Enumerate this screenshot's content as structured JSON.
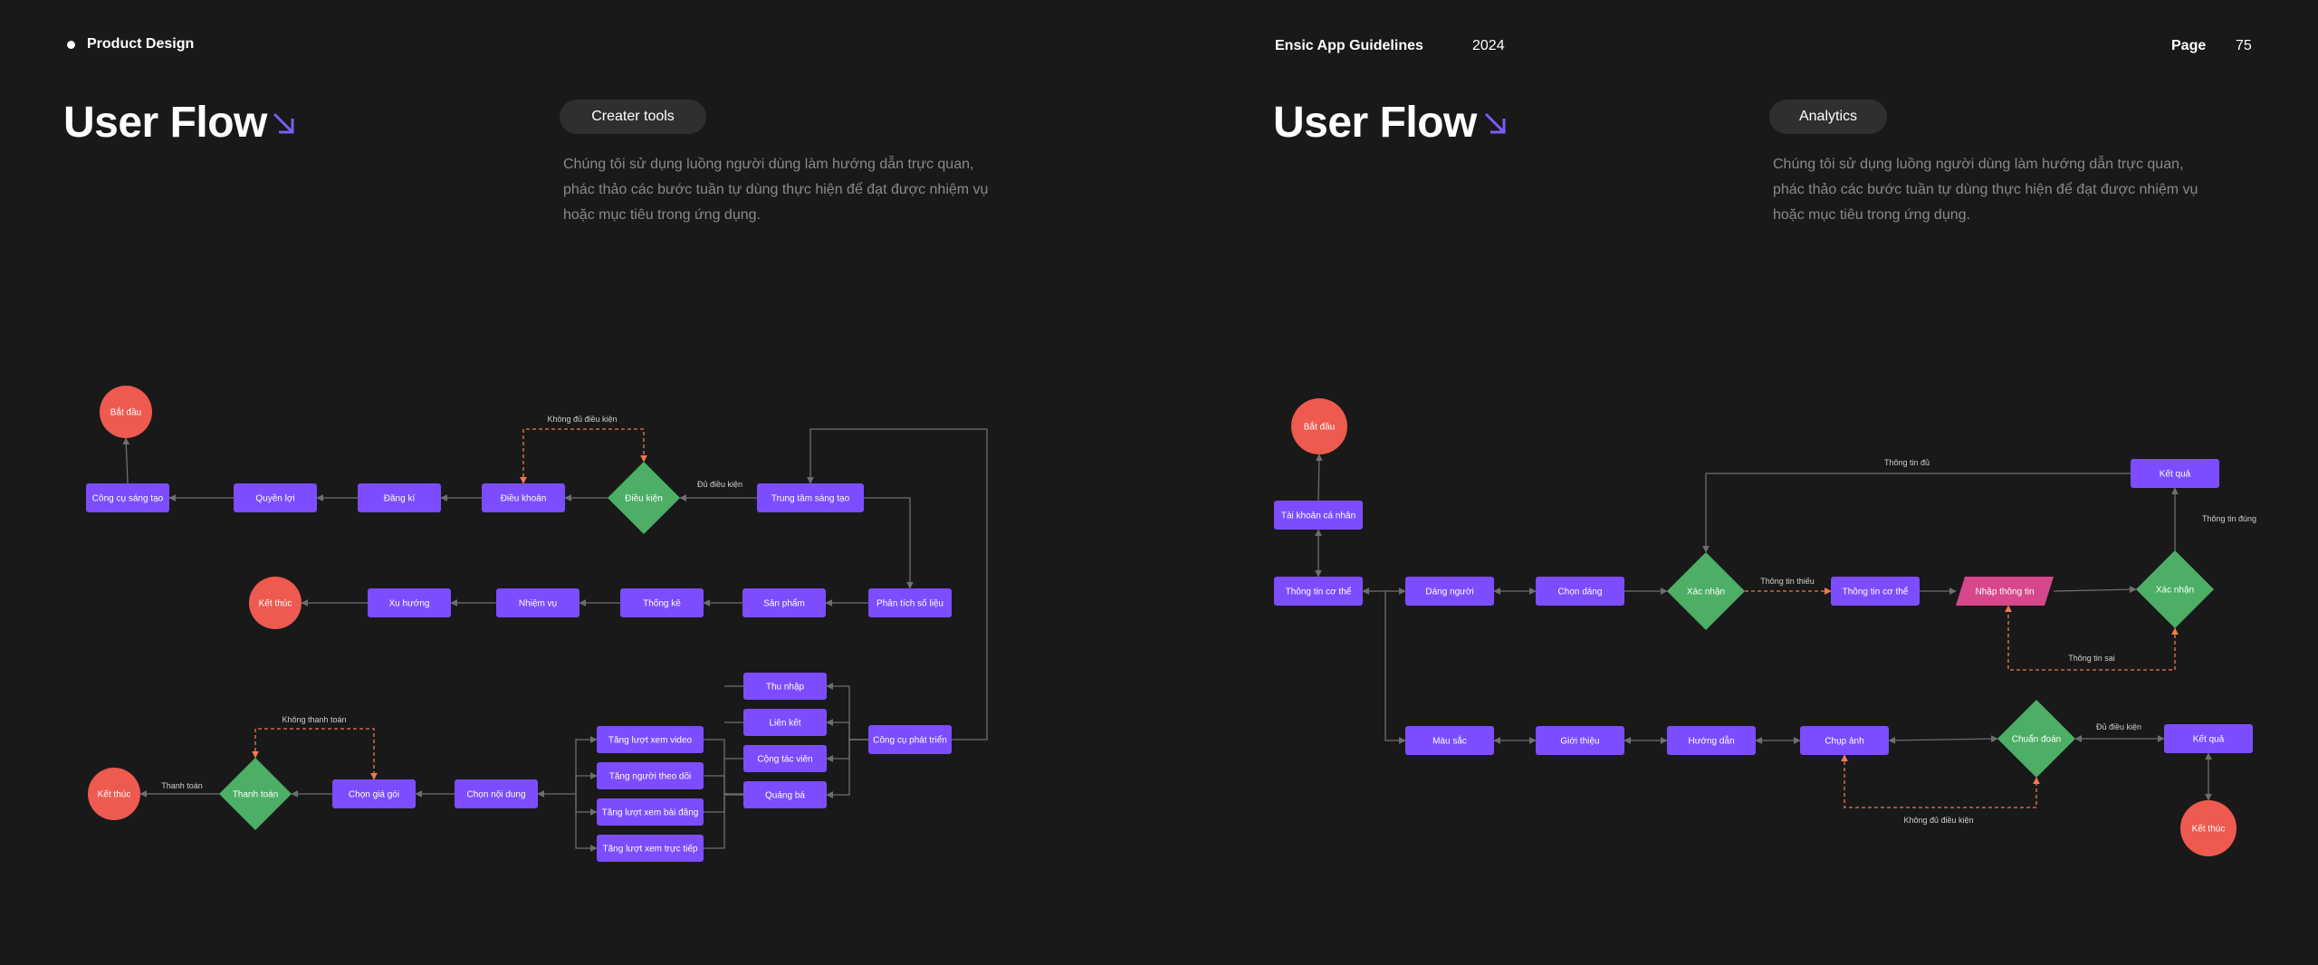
{
  "header": {
    "left_label": "Product Design",
    "guide_title": "Ensic App Guidelines",
    "year": "2024",
    "page_label": "Page",
    "page_number": "75"
  },
  "left": {
    "title": "User Flow",
    "tag": "Creater tools",
    "description_lines": [
      "Chúng tôi sử dụng luồng người dùng làm hướng dẫn trực quan,",
      "phác thảo các bước tuần tự dùng thực hiện để đạt được nhiệm vụ",
      "hoặc mục tiêu trong ứng dụng."
    ]
  },
  "right": {
    "title": "User Flow",
    "tag": "Analytics",
    "description_lines": [
      "Chúng tôi sử dụng luồng người dùng làm hướng dẫn trực quan,",
      "phác thảo các bước tuần tự dùng thực hiện để đạt được nhiệm vụ",
      "hoặc mục tiêu trong ứng dụng."
    ]
  },
  "colors": {
    "process": "#7c4dff",
    "decision": "#4caf65",
    "terminal": "#ee5a4f",
    "input": "#d6478c",
    "connector": "#6e6e6e",
    "dashed": "#f07a4a",
    "accent_arrow": "#7c5cf5"
  },
  "icons": {
    "title_arrow": "arrow-down-right-icon"
  },
  "left_flow": {
    "nodes": [
      {
        "id": "l_start",
        "type": "terminal",
        "text": "Bắt đầu"
      },
      {
        "id": "l_ccst",
        "type": "process",
        "text": "Công cụ sáng tạo"
      },
      {
        "id": "l_ql",
        "type": "process",
        "text": "Quyền lợi"
      },
      {
        "id": "l_dk",
        "type": "process",
        "text": "Đăng kí"
      },
      {
        "id": "l_dkhoan",
        "type": "process",
        "text": "Điều khoản"
      },
      {
        "id": "l_dkien",
        "type": "decision",
        "text": "Điều kiện"
      },
      {
        "id": "l_ttst",
        "type": "process",
        "text": "Trung tâm sáng tạo"
      },
      {
        "id": "l_end1",
        "type": "terminal",
        "text": "Kết thúc"
      },
      {
        "id": "l_xh",
        "type": "process",
        "text": "Xu hướng"
      },
      {
        "id": "l_nv",
        "type": "process",
        "text": "Nhiệm vụ"
      },
      {
        "id": "l_tk",
        "type": "process",
        "text": "Thống kê"
      },
      {
        "id": "l_sp",
        "type": "process",
        "text": "Sản phẩm"
      },
      {
        "id": "l_ptsl",
        "type": "process",
        "text": "Phân tích số liệu"
      },
      {
        "id": "l_tn",
        "type": "process",
        "text": "Thu nhập"
      },
      {
        "id": "l_lk",
        "type": "process",
        "text": "Liên kết"
      },
      {
        "id": "l_ctv",
        "type": "process",
        "text": "Cộng tác viên"
      },
      {
        "id": "l_qc",
        "type": "process",
        "text": "Quảng bá"
      },
      {
        "id": "l_ccpt",
        "type": "process",
        "text": "Công cụ phát triển"
      },
      {
        "id": "l_tlxv",
        "type": "process",
        "text": "Tăng lượt xem video"
      },
      {
        "id": "l_tntd",
        "type": "process",
        "text": "Tăng người theo dõi"
      },
      {
        "id": "l_tlxbd",
        "type": "process",
        "text": "Tăng lượt xem bài đăng"
      },
      {
        "id": "l_tlxtt",
        "type": "process",
        "text": "Tăng lượt xem trực tiếp"
      },
      {
        "id": "l_end2",
        "type": "terminal",
        "text": "Kết thúc"
      },
      {
        "id": "l_thtoan",
        "type": "decision",
        "text": "Thanh toán"
      },
      {
        "id": "l_cgg",
        "type": "process",
        "text": "Chọn giá gói"
      },
      {
        "id": "l_cnd",
        "type": "process",
        "text": "Chọn nội dung"
      }
    ],
    "labels": {
      "khong_du_dieu_kien": "Không đủ điều kiện",
      "du_dieu_kien": "Đủ điều kiện",
      "khong_thanh_toan": "Không thanh toán",
      "thanh_toan": "Thanh toán"
    }
  },
  "right_flow": {
    "nodes": [
      {
        "id": "r_start",
        "type": "terminal",
        "text": "Bắt đầu"
      },
      {
        "id": "r_tkcn",
        "type": "process",
        "text": "Tài khoản cá nhân"
      },
      {
        "id": "r_ttct1",
        "type": "process",
        "text": "Thông tin cơ thể"
      },
      {
        "id": "r_dn",
        "type": "process",
        "text": "Dáng người"
      },
      {
        "id": "r_cd",
        "type": "process",
        "text": "Chọn dáng"
      },
      {
        "id": "r_xn1",
        "type": "decision",
        "text": "Xác nhận"
      },
      {
        "id": "r_ttct2",
        "type": "process",
        "text": "Thông tin cơ thể"
      },
      {
        "id": "r_nhap",
        "type": "input",
        "text": "Nhập thông tin"
      },
      {
        "id": "r_xn2",
        "type": "decision",
        "text": "Xác nhận"
      },
      {
        "id": "r_kq1",
        "type": "process",
        "text": "Kết quả"
      },
      {
        "id": "r_ms",
        "type": "process",
        "text": "Màu sắc"
      },
      {
        "id": "r_gt",
        "type": "process",
        "text": "Giới thiệu"
      },
      {
        "id": "r_hd",
        "type": "process",
        "text": "Hướng dẫn"
      },
      {
        "id": "r_ca",
        "type": "process",
        "text": "Chụp ảnh"
      },
      {
        "id": "r_cdoan",
        "type": "decision",
        "text": "Chuẩn đoán"
      },
      {
        "id": "r_kq2",
        "type": "process",
        "text": "Kết quả"
      },
      {
        "id": "r_end",
        "type": "terminal",
        "text": "Kết thúc"
      }
    ],
    "labels": {
      "thong_tin_du": "Thông tin đủ",
      "thong_tin_dung": "Thông tin đúng",
      "thong_tin_thieu": "Thông tin thiếu",
      "thong_tin_sai": "Thông tin sai",
      "du_dieu_kien": "Đủ điều kiện",
      "khong_du_dieu_kien": "Không đủ điều kiện"
    }
  }
}
